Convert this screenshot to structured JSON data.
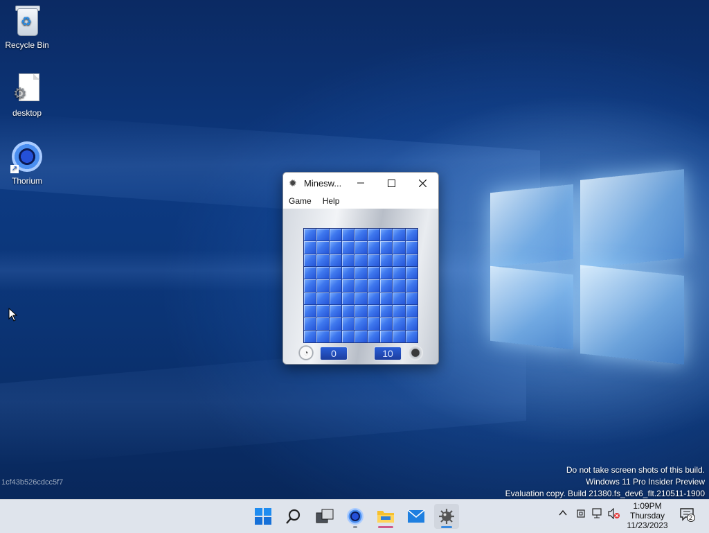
{
  "desktop": {
    "icons": [
      {
        "label": "Recycle Bin",
        "icon": "recycle-bin-icon"
      },
      {
        "label": "desktop",
        "icon": "settings-file-icon"
      },
      {
        "label": "Thorium",
        "icon": "thorium-browser-icon"
      }
    ],
    "build_id": "1cf43b526cdcc5f7",
    "watermark": {
      "line1": "Do not take screen shots of this build.",
      "line2": "Windows 11 Pro Insider Preview",
      "line3": "Evaluation copy. Build 21380.fs_dev6_flt.210511-1900"
    }
  },
  "window": {
    "title": "Minesw...",
    "menu": [
      "Game",
      "Help"
    ],
    "board": {
      "rows": 9,
      "cols": 9
    },
    "timer": "0",
    "mines_remaining": "10",
    "colors": {
      "tile": "#3f78ee",
      "counter_bg": "#2a5fd8"
    }
  },
  "taskbar": {
    "apps": [
      {
        "name": "Start",
        "icon": "windows-start-icon"
      },
      {
        "name": "Search",
        "icon": "search-icon"
      },
      {
        "name": "Task View",
        "icon": "task-view-icon"
      },
      {
        "name": "Thorium",
        "icon": "thorium-browser-icon"
      },
      {
        "name": "File Explorer",
        "icon": "folder-icon"
      },
      {
        "name": "Mail",
        "icon": "mail-icon"
      },
      {
        "name": "Minesweeper",
        "icon": "minesweeper-icon"
      }
    ],
    "clock": {
      "time": "1:09PM",
      "day": "Thursday",
      "date": "11/23/2023"
    },
    "notification_count": "2"
  }
}
